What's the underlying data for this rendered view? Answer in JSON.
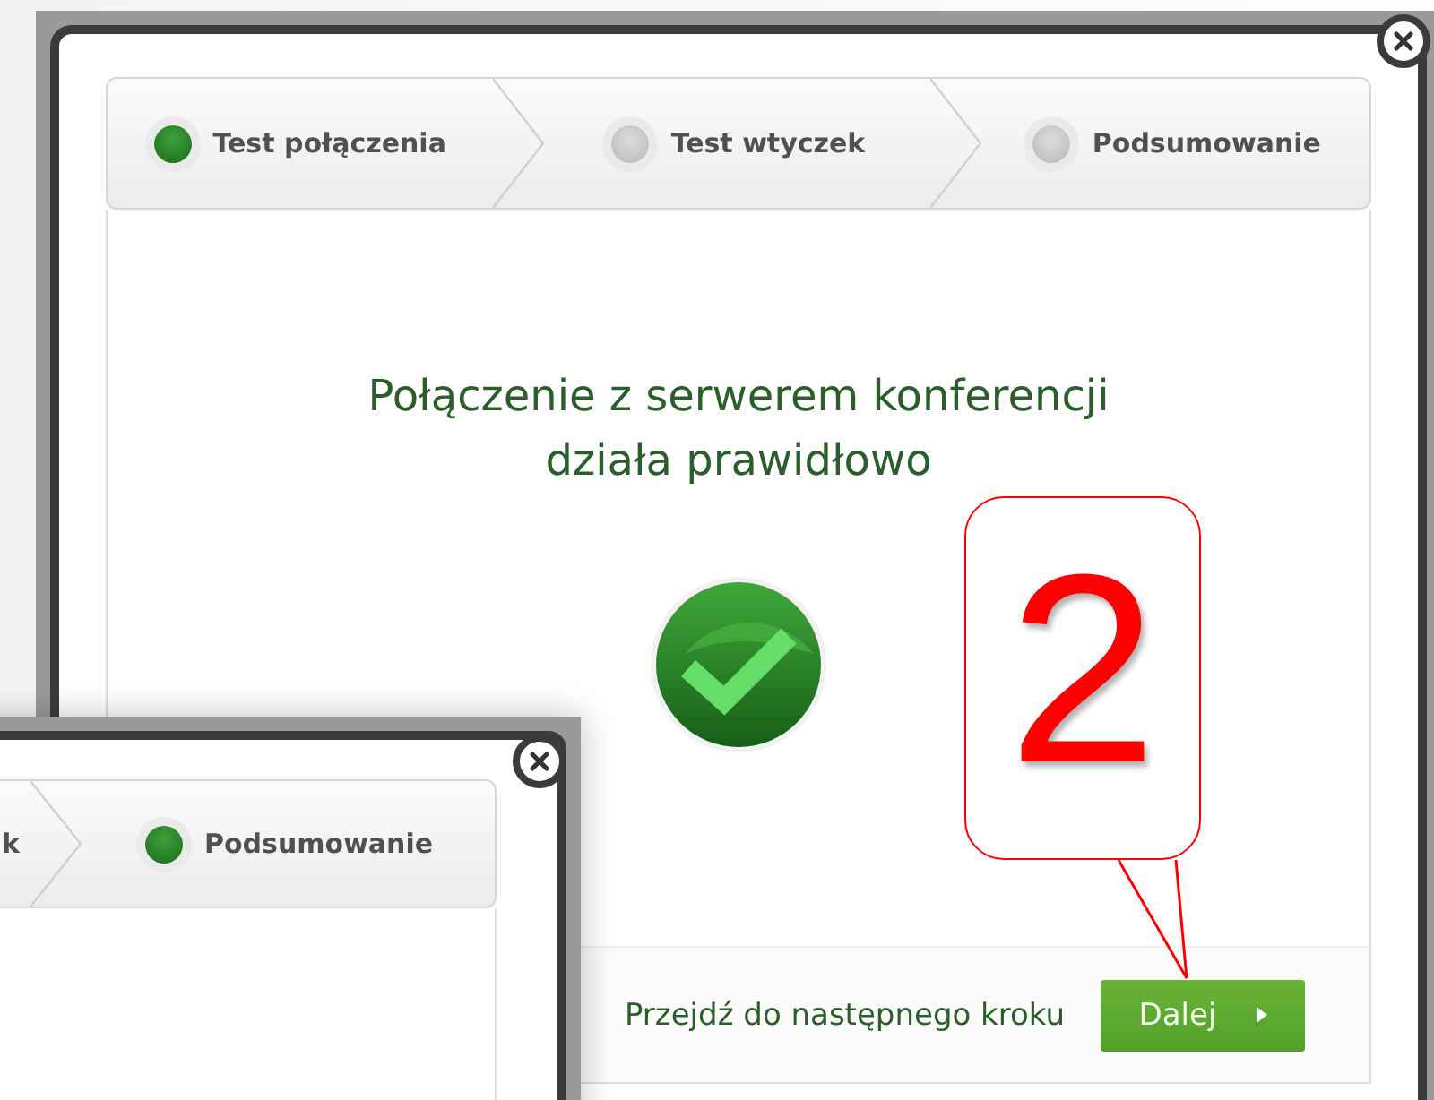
{
  "dialogs": [
    {
      "steps": [
        {
          "label": "Test połączenia",
          "done": true
        },
        {
          "label": "Test wtyczek",
          "done": false
        },
        {
          "label": "Podsumowanie",
          "done": false
        }
      ],
      "message": "Połączenie z serwerem konferencji działa prawidłowo",
      "footer": {
        "hint": "Przejdź do następnego kroku",
        "button": "Dalej"
      }
    },
    {
      "cut_step_text": "k",
      "steps": [
        {
          "label": "Podsumowanie",
          "done": true
        }
      ]
    }
  ],
  "annotation": {
    "label": "2"
  }
}
